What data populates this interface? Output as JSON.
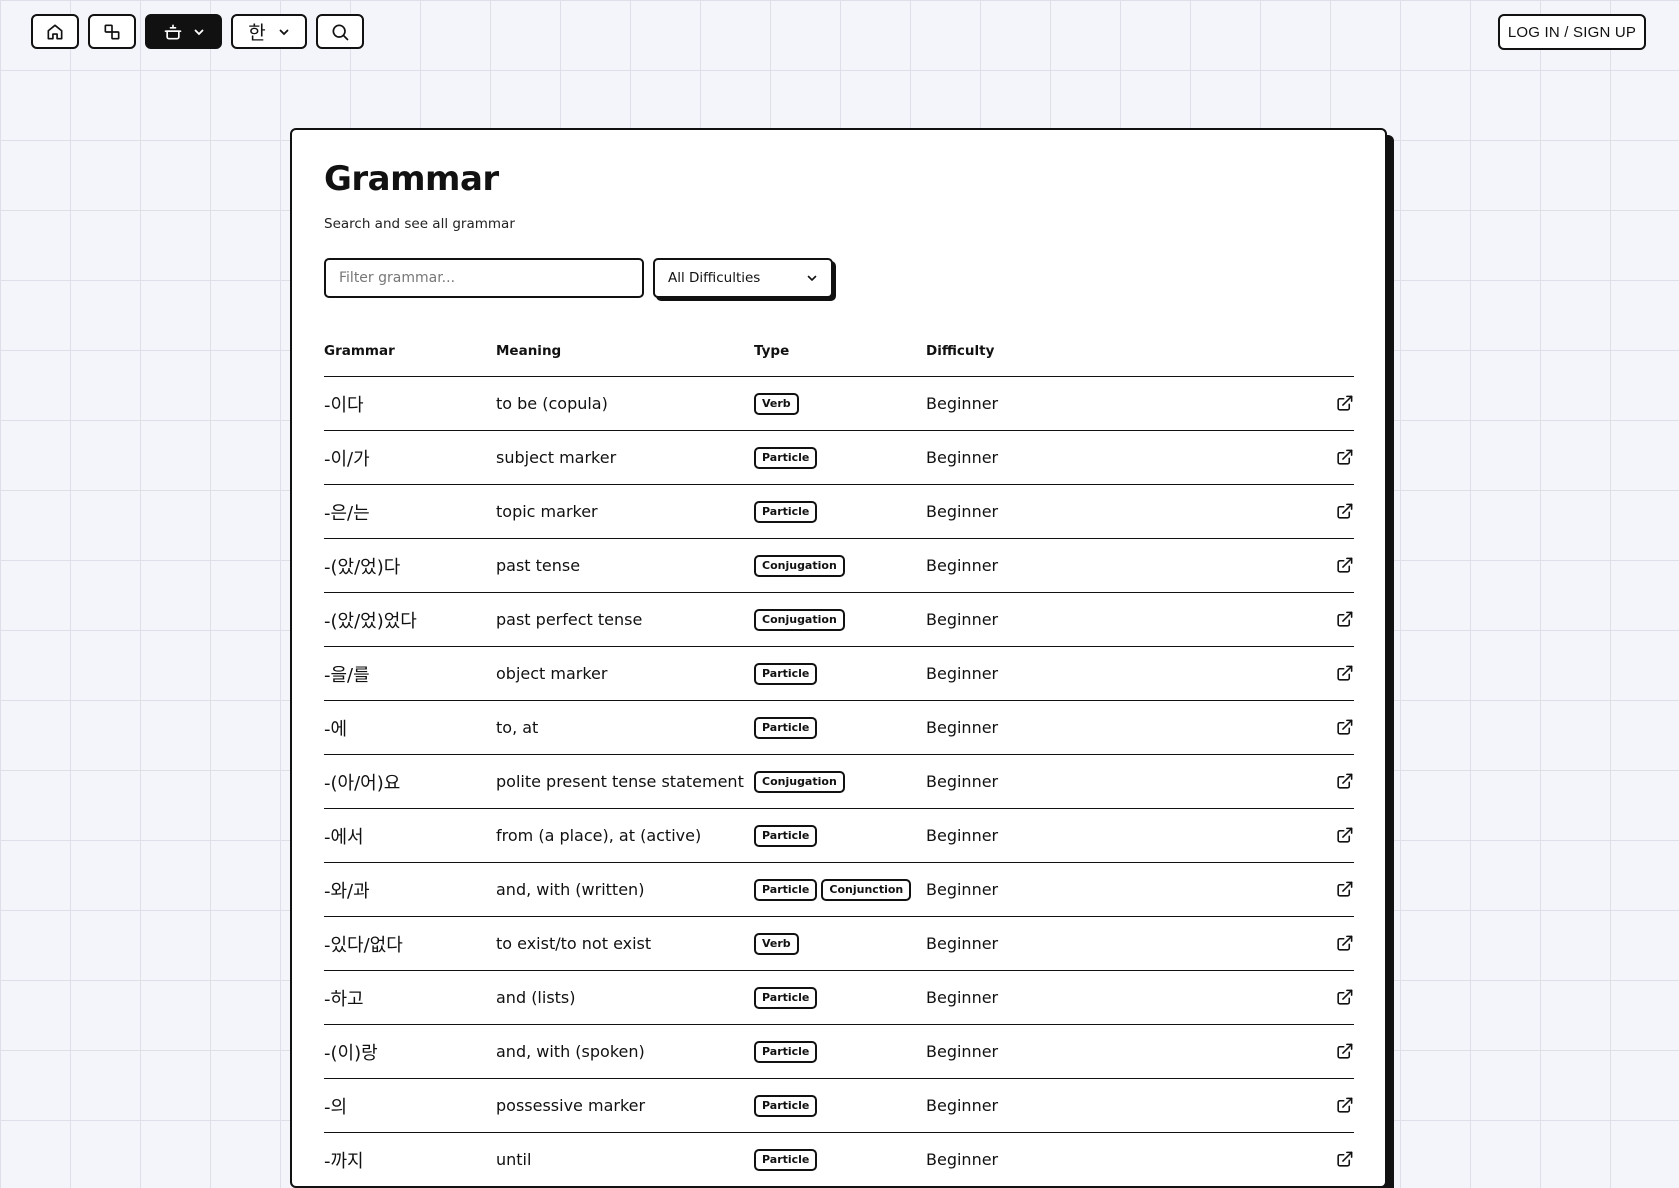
{
  "nav": {
    "lang_label": "한",
    "login_label": "LOG IN / SIGN UP"
  },
  "page": {
    "title": "Grammar",
    "subtitle": "Search and see all grammar",
    "filter_placeholder": "Filter grammar...",
    "filter_value": "",
    "difficulty_selected": "All Difficulties"
  },
  "table": {
    "headers": {
      "grammar": "Grammar",
      "meaning": "Meaning",
      "type": "Type",
      "difficulty": "Difficulty"
    },
    "rows": [
      {
        "grammar": "-이다",
        "meaning": "to be (copula)",
        "types": [
          "Verb"
        ],
        "difficulty": "Beginner"
      },
      {
        "grammar": "-이/가",
        "meaning": "subject marker",
        "types": [
          "Particle"
        ],
        "difficulty": "Beginner"
      },
      {
        "grammar": "-은/는",
        "meaning": "topic marker",
        "types": [
          "Particle"
        ],
        "difficulty": "Beginner"
      },
      {
        "grammar": "-(았/었)다",
        "meaning": "past tense",
        "types": [
          "Conjugation"
        ],
        "difficulty": "Beginner"
      },
      {
        "grammar": "-(았/었)었다",
        "meaning": "past perfect tense",
        "types": [
          "Conjugation"
        ],
        "difficulty": "Beginner"
      },
      {
        "grammar": "-을/를",
        "meaning": "object marker",
        "types": [
          "Particle"
        ],
        "difficulty": "Beginner"
      },
      {
        "grammar": "-에",
        "meaning": "to, at",
        "types": [
          "Particle"
        ],
        "difficulty": "Beginner"
      },
      {
        "grammar": "-(아/어)요",
        "meaning": "polite present tense statement",
        "types": [
          "Conjugation"
        ],
        "difficulty": "Beginner"
      },
      {
        "grammar": "-에서",
        "meaning": "from (a place), at (active)",
        "types": [
          "Particle"
        ],
        "difficulty": "Beginner"
      },
      {
        "grammar": "-와/과",
        "meaning": "and, with (written)",
        "types": [
          "Particle",
          "Conjunction"
        ],
        "difficulty": "Beginner"
      },
      {
        "grammar": "-있다/없다",
        "meaning": "to exist/to not exist",
        "types": [
          "Verb"
        ],
        "difficulty": "Beginner"
      },
      {
        "grammar": "-하고",
        "meaning": "and (lists)",
        "types": [
          "Particle"
        ],
        "difficulty": "Beginner"
      },
      {
        "grammar": "-(이)랑",
        "meaning": "and, with (spoken)",
        "types": [
          "Particle"
        ],
        "difficulty": "Beginner"
      },
      {
        "grammar": "-의",
        "meaning": "possessive marker",
        "types": [
          "Particle"
        ],
        "difficulty": "Beginner"
      },
      {
        "grammar": "-까지",
        "meaning": "until",
        "types": [
          "Particle"
        ],
        "difficulty": "Beginner"
      }
    ]
  }
}
